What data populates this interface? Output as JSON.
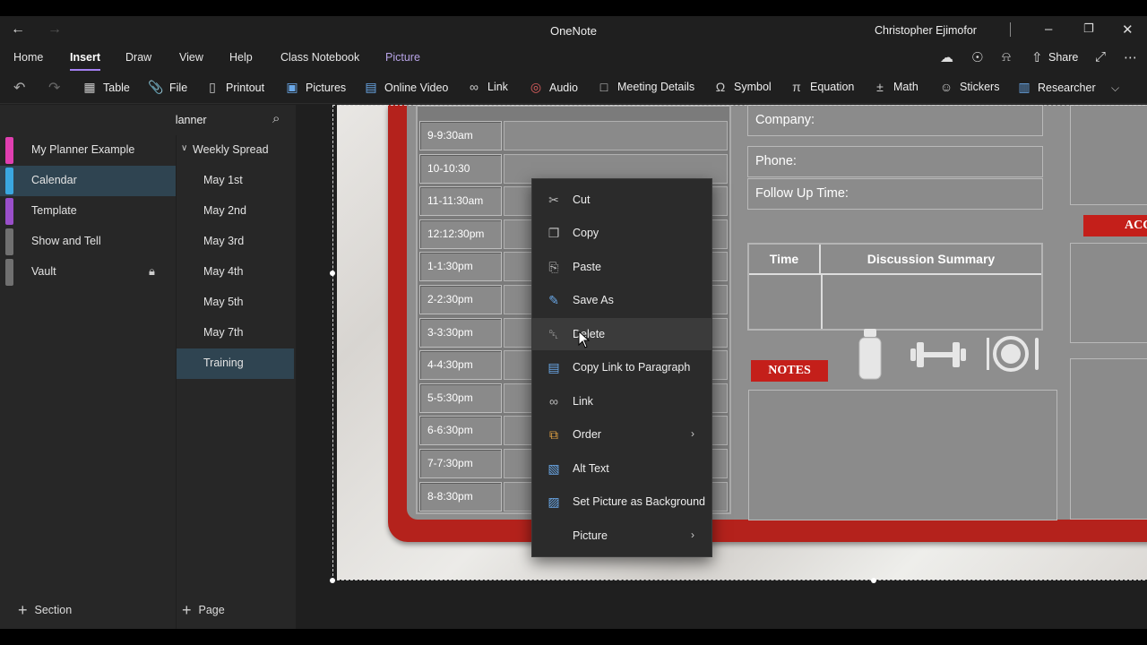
{
  "titlebar": {
    "app_title": "OneNote",
    "user_name": "Christopher Ejimofor"
  },
  "menu": {
    "tabs": [
      "Home",
      "Insert",
      "Draw",
      "View",
      "Help",
      "Class Notebook",
      "Picture"
    ],
    "active_tab": "Insert",
    "share_label": "Share"
  },
  "ribbon": {
    "items": [
      "Table",
      "File",
      "Printout",
      "Pictures",
      "Online Video",
      "Link",
      "Audio",
      "Meeting Details",
      "Symbol",
      "Equation",
      "Math",
      "Stickers",
      "Researcher"
    ]
  },
  "notebook": {
    "title": "Spiral Binder Planner",
    "sections": [
      {
        "label": "My Planner Example",
        "color": "#e03fb0"
      },
      {
        "label": "Calendar",
        "color": "#3aa7e0"
      },
      {
        "label": "Template",
        "color": "#9a4fc9"
      },
      {
        "label": "Show and Tell",
        "color": "#707070"
      },
      {
        "label": "Vault",
        "color": "#707070"
      }
    ],
    "selected_section": "Calendar",
    "pages": [
      {
        "label": "Weekly Spread"
      },
      {
        "label": "May 1st"
      },
      {
        "label": "May 2nd"
      },
      {
        "label": "May 3rd"
      },
      {
        "label": "May 4th"
      },
      {
        "label": "May 5th"
      },
      {
        "label": "May 7th"
      },
      {
        "label": "Training"
      }
    ],
    "selected_page": "Training",
    "add_section_label": "Section",
    "add_page_label": "Page"
  },
  "planner": {
    "times": [
      "9-9:30am",
      "10-10:30",
      "11-11:30am",
      "12:12:30pm",
      "1-1:30pm",
      "2-2:30pm",
      "3-3:30pm",
      "4-4:30pm",
      "5-5:30pm",
      "6-6:30pm",
      "7-7:30pm",
      "8-8:30pm"
    ],
    "company_label": "Company:",
    "phone_label": "Phone:",
    "followup_label": "Follow Up Time:",
    "time_header": "Time",
    "summary_header": "Discussion Summary",
    "notes_label": "NOTES",
    "acc_label": "ACC"
  },
  "context_menu": {
    "items": [
      {
        "label": "Cut",
        "icon": "scissors-icon"
      },
      {
        "label": "Copy",
        "icon": "copy-icon"
      },
      {
        "label": "Paste",
        "icon": "paste-icon"
      },
      {
        "label": "Save As",
        "icon": "save-as-icon"
      },
      {
        "label": "Delete",
        "icon": "trash-icon"
      },
      {
        "label": "Copy Link to Paragraph",
        "icon": "link-paragraph-icon"
      },
      {
        "label": "Link",
        "icon": "link-icon"
      },
      {
        "label": "Order",
        "icon": "order-icon"
      },
      {
        "label": "Alt Text",
        "icon": "alt-text-icon"
      },
      {
        "label": "Set Picture as Background",
        "icon": "picture-background-icon"
      },
      {
        "label": "Picture",
        "icon": ""
      }
    ],
    "hovered": "Delete"
  }
}
